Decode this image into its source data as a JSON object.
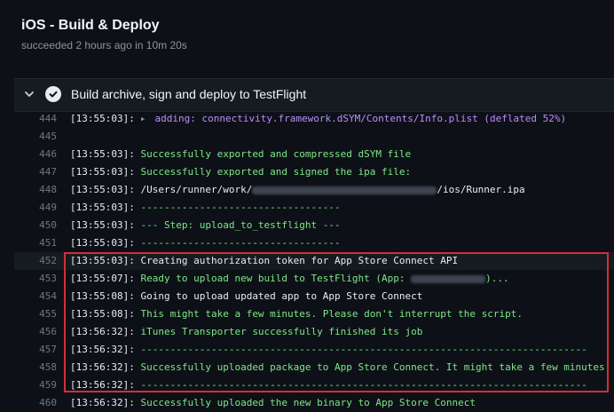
{
  "header": {
    "title": "iOS - Build & Deploy",
    "subtitle": "succeeded 2 hours ago in 10m 20s"
  },
  "step": {
    "title": "Build archive, sign and deploy to TestFlight"
  },
  "colors": {
    "background": "#0d1117",
    "green_text": "#7ee787",
    "purple_text": "#bc8cff",
    "highlight_border": "#d22f35"
  },
  "log_lines": [
    {
      "n": "444",
      "ts": "[13:55:03]:",
      "arrow": "▸",
      "msg": "adding: connectivity.framework.dSYM/Contents/Info.plist (deflated 52%)"
    },
    {
      "n": "445",
      "ts": "",
      "msg": ""
    },
    {
      "n": "446",
      "ts": "[13:55:03]:",
      "msg": "Successfully exported and compressed dSYM file"
    },
    {
      "n": "447",
      "ts": "[13:55:03]:",
      "msg": "Successfully exported and signed the ipa file:"
    },
    {
      "n": "448",
      "ts": "[13:55:03]:",
      "msg_pre": "/Users/runner/work/",
      "msg_post": "/ios/Runner.ipa"
    },
    {
      "n": "449",
      "ts": "[13:55:03]:",
      "msg": "----------------------------------"
    },
    {
      "n": "450",
      "ts": "[13:55:03]:",
      "msg": "--- Step: upload_to_testflight ---"
    },
    {
      "n": "451",
      "ts": "[13:55:03]:",
      "msg": "----------------------------------"
    },
    {
      "n": "452",
      "ts": "[13:55:03]:",
      "msg": "Creating authorization token for App Store Connect API"
    },
    {
      "n": "453",
      "ts": "[13:55:07]:",
      "msg_pre": "Ready to upload new build to TestFlight (App: ",
      "msg_post": ")..."
    },
    {
      "n": "454",
      "ts": "[13:55:08]:",
      "msg": "Going to upload updated app to App Store Connect"
    },
    {
      "n": "455",
      "ts": "[13:55:08]:",
      "msg": "This might take a few minutes. Please don't interrupt the script."
    },
    {
      "n": "456",
      "ts": "[13:56:32]:",
      "msg": "iTunes Transporter successfully finished its job"
    },
    {
      "n": "457",
      "ts": "[13:56:32]:",
      "msg": "----------------------------------------------------------------------------"
    },
    {
      "n": "458",
      "ts": "[13:56:32]:",
      "msg": "Successfully uploaded package to App Store Connect. It might take a few minutes."
    },
    {
      "n": "459",
      "ts": "[13:56:32]:",
      "msg": "----------------------------------------------------------------------------"
    },
    {
      "n": "460",
      "ts": "[13:56:32]:",
      "msg": "Successfully uploaded the new binary to App Store Connect"
    }
  ]
}
